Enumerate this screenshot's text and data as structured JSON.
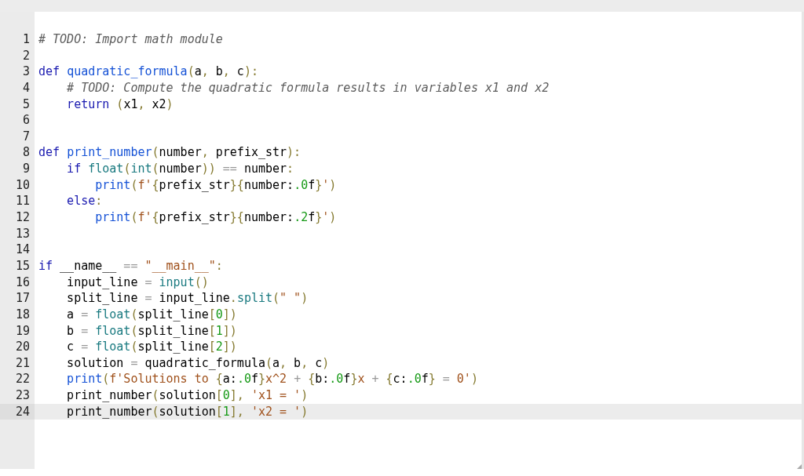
{
  "lines": [
    {
      "number": "1",
      "selected": false,
      "tokens": [
        {
          "kind": "comment",
          "text": "# TODO: Import math module"
        }
      ]
    },
    {
      "number": "2",
      "selected": false
    },
    {
      "number": "3",
      "selected": false,
      "tokens": [
        {
          "kind": "keyword",
          "text": "def "
        },
        {
          "kind": "func",
          "text": "quadratic_formula"
        },
        {
          "kind": "bracket",
          "text": "("
        },
        {
          "kind": "plain",
          "text": "a"
        },
        {
          "kind": "bracket",
          "text": ","
        },
        {
          "kind": "plain",
          "text": " b"
        },
        {
          "kind": "bracket",
          "text": ","
        },
        {
          "kind": "plain",
          "text": " c"
        },
        {
          "kind": "bracket",
          "text": "):"
        }
      ]
    },
    {
      "number": "4",
      "selected": false,
      "tokens": [
        {
          "kind": "comment",
          "text": "    # TODO: Compute the quadratic formula results in variables x1 and x2"
        }
      ]
    },
    {
      "number": "5",
      "selected": false,
      "tokens": [
        {
          "kind": "keyword",
          "text": "    return "
        },
        {
          "kind": "bracket",
          "text": "("
        },
        {
          "kind": "plain",
          "text": "x1"
        },
        {
          "kind": "bracket",
          "text": ","
        },
        {
          "kind": "plain",
          "text": " x2"
        },
        {
          "kind": "bracket",
          "text": ")"
        }
      ]
    },
    {
      "number": "6",
      "selected": false
    },
    {
      "number": "7",
      "selected": false
    },
    {
      "number": "8",
      "selected": false,
      "tokens": [
        {
          "kind": "keyword",
          "text": "def "
        },
        {
          "kind": "func",
          "text": "print_number"
        },
        {
          "kind": "bracket",
          "text": "("
        },
        {
          "kind": "plain",
          "text": "number"
        },
        {
          "kind": "bracket",
          "text": ","
        },
        {
          "kind": "plain",
          "text": " prefix_str"
        },
        {
          "kind": "bracket",
          "text": "):"
        }
      ]
    },
    {
      "number": "9",
      "selected": false,
      "tokens": [
        {
          "kind": "keyword",
          "text": "    if "
        },
        {
          "kind": "builtin",
          "text": "float"
        },
        {
          "kind": "bracket",
          "text": "("
        },
        {
          "kind": "builtin",
          "text": "int"
        },
        {
          "kind": "bracket",
          "text": "("
        },
        {
          "kind": "plain",
          "text": "number"
        },
        {
          "kind": "bracket",
          "text": "))"
        },
        {
          "kind": "operator",
          "text": " =="
        },
        {
          "kind": "plain",
          "text": " number"
        },
        {
          "kind": "bracket",
          "text": ":"
        }
      ]
    },
    {
      "number": "10",
      "selected": false,
      "tokens": [
        {
          "kind": "func",
          "text": "        print"
        },
        {
          "kind": "bracket",
          "text": "("
        },
        {
          "kind": "string",
          "text": "f'"
        },
        {
          "kind": "bracket",
          "text": "{"
        },
        {
          "kind": "plain",
          "text": "prefix_str"
        },
        {
          "kind": "bracket",
          "text": "}{"
        },
        {
          "kind": "plain",
          "text": "number:"
        },
        {
          "kind": "number",
          "text": ".0"
        },
        {
          "kind": "plain",
          "text": "f"
        },
        {
          "kind": "bracket",
          "text": "}"
        },
        {
          "kind": "string",
          "text": "'"
        },
        {
          "kind": "bracket",
          "text": ")"
        }
      ]
    },
    {
      "number": "11",
      "selected": false,
      "tokens": [
        {
          "kind": "keyword",
          "text": "    else"
        },
        {
          "kind": "bracket",
          "text": ":"
        }
      ]
    },
    {
      "number": "12",
      "selected": false,
      "tokens": [
        {
          "kind": "func",
          "text": "        print"
        },
        {
          "kind": "bracket",
          "text": "("
        },
        {
          "kind": "string",
          "text": "f'"
        },
        {
          "kind": "bracket",
          "text": "{"
        },
        {
          "kind": "plain",
          "text": "prefix_str"
        },
        {
          "kind": "bracket",
          "text": "}{"
        },
        {
          "kind": "plain",
          "text": "number:"
        },
        {
          "kind": "number",
          "text": ".2"
        },
        {
          "kind": "plain",
          "text": "f"
        },
        {
          "kind": "bracket",
          "text": "}"
        },
        {
          "kind": "string",
          "text": "'"
        },
        {
          "kind": "bracket",
          "text": ")"
        }
      ]
    },
    {
      "number": "13",
      "selected": false
    },
    {
      "number": "14",
      "selected": false
    },
    {
      "number": "15",
      "selected": false,
      "tokens": [
        {
          "kind": "keyword",
          "text": "if"
        },
        {
          "kind": "plain",
          "text": " __name__"
        },
        {
          "kind": "operator",
          "text": " == "
        },
        {
          "kind": "string",
          "text": "\"__main__\""
        },
        {
          "kind": "bracket",
          "text": ":"
        }
      ]
    },
    {
      "number": "16",
      "selected": false,
      "tokens": [
        {
          "kind": "plain",
          "text": "    input_line"
        },
        {
          "kind": "operator",
          "text": " = "
        },
        {
          "kind": "builtin",
          "text": "input"
        },
        {
          "kind": "bracket",
          "text": "()"
        }
      ]
    },
    {
      "number": "17",
      "selected": false,
      "tokens": [
        {
          "kind": "plain",
          "text": "    split_line"
        },
        {
          "kind": "operator",
          "text": " ="
        },
        {
          "kind": "plain",
          "text": " input_line"
        },
        {
          "kind": "bracket",
          "text": "."
        },
        {
          "kind": "builtin",
          "text": "split"
        },
        {
          "kind": "bracket",
          "text": "("
        },
        {
          "kind": "string",
          "text": "\" \""
        },
        {
          "kind": "bracket",
          "text": ")"
        }
      ]
    },
    {
      "number": "18",
      "selected": false,
      "tokens": [
        {
          "kind": "plain",
          "text": "    a"
        },
        {
          "kind": "operator",
          "text": " = "
        },
        {
          "kind": "builtin",
          "text": "float"
        },
        {
          "kind": "bracket",
          "text": "("
        },
        {
          "kind": "plain",
          "text": "split_line"
        },
        {
          "kind": "bracket",
          "text": "["
        },
        {
          "kind": "number",
          "text": "0"
        },
        {
          "kind": "bracket",
          "text": "])"
        }
      ]
    },
    {
      "number": "19",
      "selected": false,
      "tokens": [
        {
          "kind": "plain",
          "text": "    b"
        },
        {
          "kind": "operator",
          "text": " = "
        },
        {
          "kind": "builtin",
          "text": "float"
        },
        {
          "kind": "bracket",
          "text": "("
        },
        {
          "kind": "plain",
          "text": "split_line"
        },
        {
          "kind": "bracket",
          "text": "["
        },
        {
          "kind": "number",
          "text": "1"
        },
        {
          "kind": "bracket",
          "text": "])"
        }
      ]
    },
    {
      "number": "20",
      "selected": false,
      "tokens": [
        {
          "kind": "plain",
          "text": "    c"
        },
        {
          "kind": "operator",
          "text": " = "
        },
        {
          "kind": "builtin",
          "text": "float"
        },
        {
          "kind": "bracket",
          "text": "("
        },
        {
          "kind": "plain",
          "text": "split_line"
        },
        {
          "kind": "bracket",
          "text": "["
        },
        {
          "kind": "number",
          "text": "2"
        },
        {
          "kind": "bracket",
          "text": "])"
        }
      ]
    },
    {
      "number": "21",
      "selected": false,
      "tokens": [
        {
          "kind": "plain",
          "text": "    solution"
        },
        {
          "kind": "operator",
          "text": " ="
        },
        {
          "kind": "plain",
          "text": " quadratic_formula"
        },
        {
          "kind": "bracket",
          "text": "("
        },
        {
          "kind": "plain",
          "text": "a"
        },
        {
          "kind": "bracket",
          "text": ","
        },
        {
          "kind": "plain",
          "text": " b"
        },
        {
          "kind": "bracket",
          "text": ","
        },
        {
          "kind": "plain",
          "text": " c"
        },
        {
          "kind": "bracket",
          "text": ")"
        }
      ]
    },
    {
      "number": "22",
      "selected": false,
      "tokens": [
        {
          "kind": "func",
          "text": "    print"
        },
        {
          "kind": "bracket",
          "text": "("
        },
        {
          "kind": "string",
          "text": "f'Solutions to "
        },
        {
          "kind": "bracket",
          "text": "{"
        },
        {
          "kind": "plain",
          "text": "a:"
        },
        {
          "kind": "number",
          "text": ".0"
        },
        {
          "kind": "plain",
          "text": "f"
        },
        {
          "kind": "bracket",
          "text": "}"
        },
        {
          "kind": "string",
          "text": "x^2 "
        },
        {
          "kind": "operator",
          "text": "+ "
        },
        {
          "kind": "bracket",
          "text": "{"
        },
        {
          "kind": "plain",
          "text": "b:"
        },
        {
          "kind": "number",
          "text": ".0"
        },
        {
          "kind": "plain",
          "text": "f"
        },
        {
          "kind": "bracket",
          "text": "}"
        },
        {
          "kind": "string",
          "text": "x "
        },
        {
          "kind": "operator",
          "text": "+ "
        },
        {
          "kind": "bracket",
          "text": "{"
        },
        {
          "kind": "plain",
          "text": "c:"
        },
        {
          "kind": "number",
          "text": ".0"
        },
        {
          "kind": "plain",
          "text": "f"
        },
        {
          "kind": "bracket",
          "text": "}"
        },
        {
          "kind": "operator",
          "text": " ="
        },
        {
          "kind": "string",
          "text": " 0'"
        },
        {
          "kind": "bracket",
          "text": ")"
        }
      ]
    },
    {
      "number": "23",
      "selected": false,
      "tokens": [
        {
          "kind": "plain",
          "text": "    print_number"
        },
        {
          "kind": "bracket",
          "text": "("
        },
        {
          "kind": "plain",
          "text": "solution"
        },
        {
          "kind": "bracket",
          "text": "["
        },
        {
          "kind": "number",
          "text": "0"
        },
        {
          "kind": "bracket",
          "text": "],"
        },
        {
          "kind": "string",
          "text": " 'x1 = '"
        },
        {
          "kind": "bracket",
          "text": ")"
        }
      ]
    },
    {
      "number": "24",
      "selected": true,
      "tokens": [
        {
          "kind": "plain",
          "text": "    print_number"
        },
        {
          "kind": "bracket",
          "text": "("
        },
        {
          "kind": "plain",
          "text": "solution"
        },
        {
          "kind": "bracket",
          "text": "["
        },
        {
          "kind": "number",
          "text": "1"
        },
        {
          "kind": "bracket",
          "text": "],"
        },
        {
          "kind": "string",
          "text": " 'x2 = '"
        },
        {
          "kind": "bracket",
          "text": ")"
        }
      ]
    }
  ]
}
